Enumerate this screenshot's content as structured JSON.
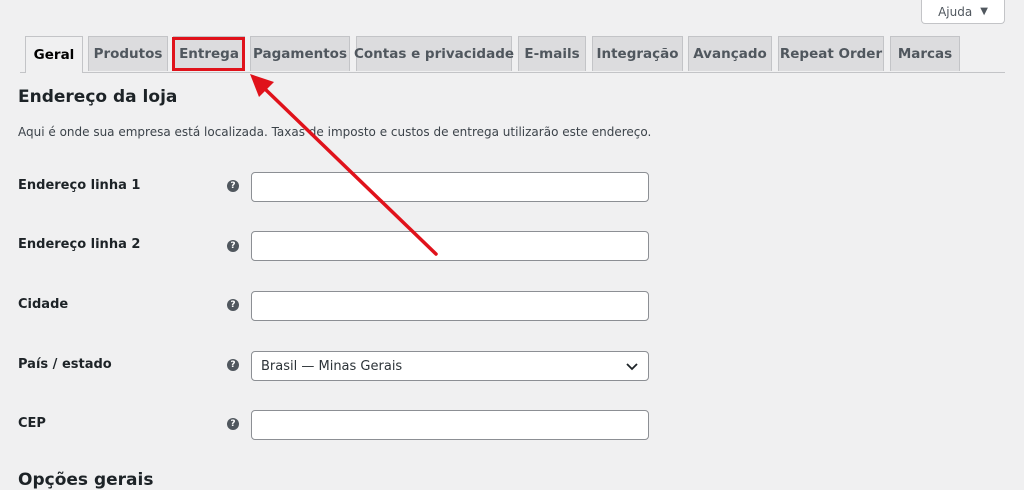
{
  "help": {
    "label": "Ajuda",
    "arrow": "▼"
  },
  "tabs": [
    {
      "label": "Geral"
    },
    {
      "label": "Produtos"
    },
    {
      "label": "Entrega"
    },
    {
      "label": "Pagamentos"
    },
    {
      "label": "Contas e privacidade"
    },
    {
      "label": "E-mails"
    },
    {
      "label": "Integração"
    },
    {
      "label": "Avançado"
    },
    {
      "label": "Repeat Order"
    },
    {
      "label": "Marcas"
    }
  ],
  "store_address": {
    "title": "Endereço da loja",
    "description": "Aqui é onde sua empresa está localizada. Taxas de imposto e custos de entrega utilizarão este endereço.",
    "fields": [
      {
        "label": "Endereço linha 1",
        "value": ""
      },
      {
        "label": "Endereço linha 2",
        "value": ""
      },
      {
        "label": "Cidade",
        "value": ""
      },
      {
        "label": "País / estado",
        "value": "Brasil — Minas Gerais"
      },
      {
        "label": "CEP",
        "value": ""
      }
    ],
    "help_glyph": "?"
  },
  "general_options": {
    "title": "Opções gerais"
  },
  "colors": {
    "highlight": "#e0121b",
    "arrow": "#e0121b"
  }
}
